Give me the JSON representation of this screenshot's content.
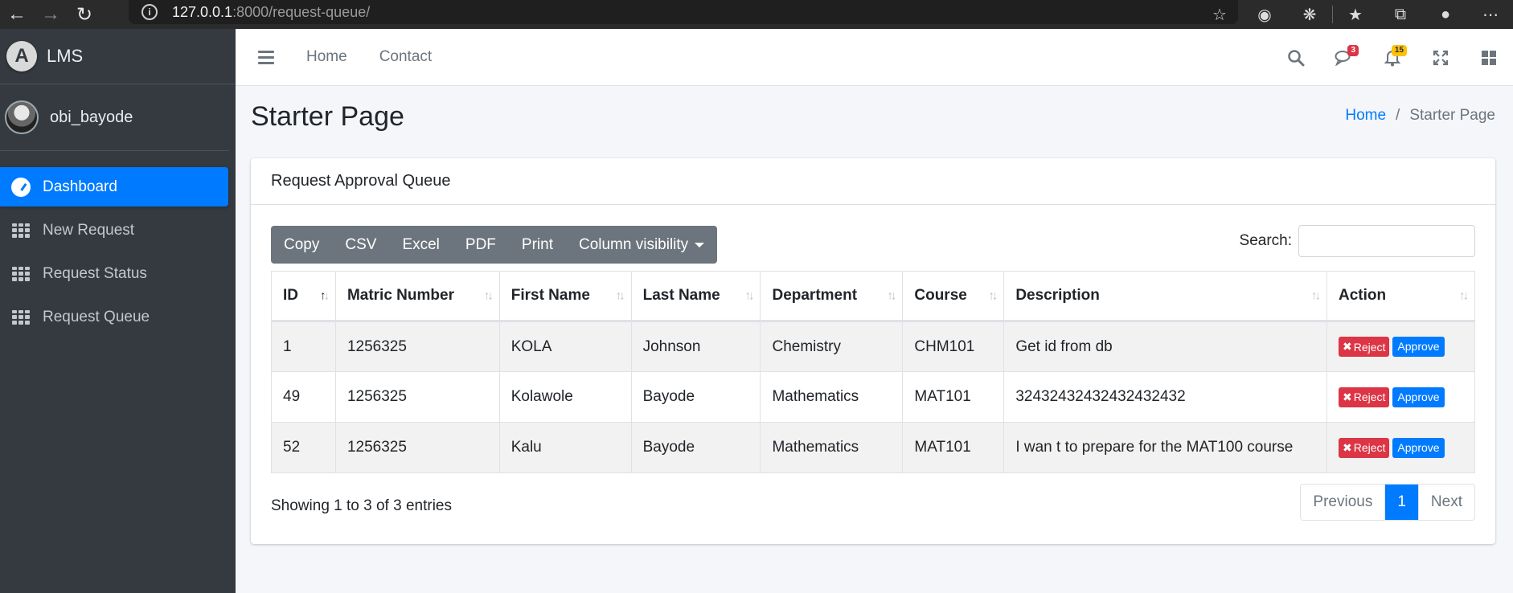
{
  "browser": {
    "url_host": "127.0.0.1",
    "url_rest": ":8000/request-queue/"
  },
  "sidebar": {
    "brand": "LMS",
    "brand_logo_letter": "A",
    "user": "obi_bayode",
    "items": [
      {
        "label": "Dashboard",
        "icon": "dashboard-gauge-icon",
        "active": true
      },
      {
        "label": "New Request",
        "icon": "grid-icon",
        "active": false
      },
      {
        "label": "Request Status",
        "icon": "grid-icon",
        "active": false
      },
      {
        "label": "Request Queue",
        "icon": "grid-icon",
        "active": false
      }
    ]
  },
  "topbar": {
    "links": [
      "Home",
      "Contact"
    ],
    "messages_badge": "3",
    "notifications_badge": "15"
  },
  "header": {
    "title": "Starter Page",
    "breadcrumb_home": "Home",
    "breadcrumb_sep": "/",
    "breadcrumb_current": "Starter Page"
  },
  "card": {
    "title": "Request Approval Queue",
    "buttons": [
      "Copy",
      "CSV",
      "Excel",
      "PDF",
      "Print",
      "Column visibility"
    ],
    "search_label": "Search:",
    "search_value": ""
  },
  "table": {
    "columns": [
      "ID",
      "Matric Number",
      "First Name",
      "Last Name",
      "Department",
      "Course",
      "Description",
      "Action"
    ],
    "rows": [
      {
        "id": "1",
        "matric": "1256325",
        "first": "KOLA",
        "last": "Johnson",
        "dept": "Chemistry",
        "course": "CHM101",
        "desc": "Get id from db"
      },
      {
        "id": "49",
        "matric": "1256325",
        "first": "Kolawole",
        "last": "Bayode",
        "dept": "Mathematics",
        "course": "MAT101",
        "desc": "32432432432432432432"
      },
      {
        "id": "52",
        "matric": "1256325",
        "first": "Kalu",
        "last": "Bayode",
        "dept": "Mathematics",
        "course": "MAT101",
        "desc": "I wan t to prepare for the MAT100 course"
      }
    ],
    "reject_label": "Reject",
    "approve_label": "Approve"
  },
  "footer": {
    "info": "Showing 1 to 3 of 3 entries",
    "previous": "Previous",
    "page": "1",
    "next": "Next"
  },
  "colors": {
    "primary": "#007bff",
    "sidebar_bg": "#343a40",
    "danger": "#dc3545",
    "secondary": "#6c757d"
  }
}
